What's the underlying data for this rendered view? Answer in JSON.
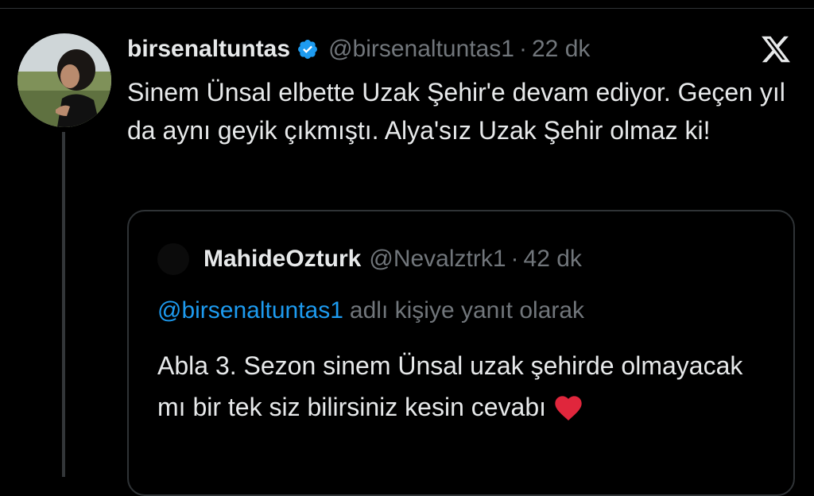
{
  "tweet": {
    "display_name": "birsenaltuntas",
    "handle": "@birsenaltuntas1",
    "separator": "·",
    "time": "22 dk",
    "text": "Sinem Ünsal elbette Uzak Şehir'e devam ediyor. Geçen yıl da aynı geyik çıkmıştı. Alya'sız Uzak Şehir olmaz ki!"
  },
  "quoted": {
    "display_name": "MahideOzturk",
    "handle": "@Nevalztrk1",
    "separator": "·",
    "time": "42 dk",
    "reply_mention": "@birsenaltuntas1",
    "reply_suffix": "adlı kişiye yanıt olarak",
    "text": "Abla 3. Sezon sinem Ünsal uzak şehirde olmayacak mı bir tek siz bilirsiniz kesin cevabı"
  },
  "icons": {
    "verified": "verified-badge-icon",
    "platform": "x-logo-icon",
    "emoji": "red-heart-icon"
  },
  "colors": {
    "background": "#000000",
    "text": "#e7e9ea",
    "muted": "#71767b",
    "link": "#1d9bf0",
    "verified": "#1d9bf0",
    "border": "#2f3336",
    "heart": "#e0263c"
  }
}
